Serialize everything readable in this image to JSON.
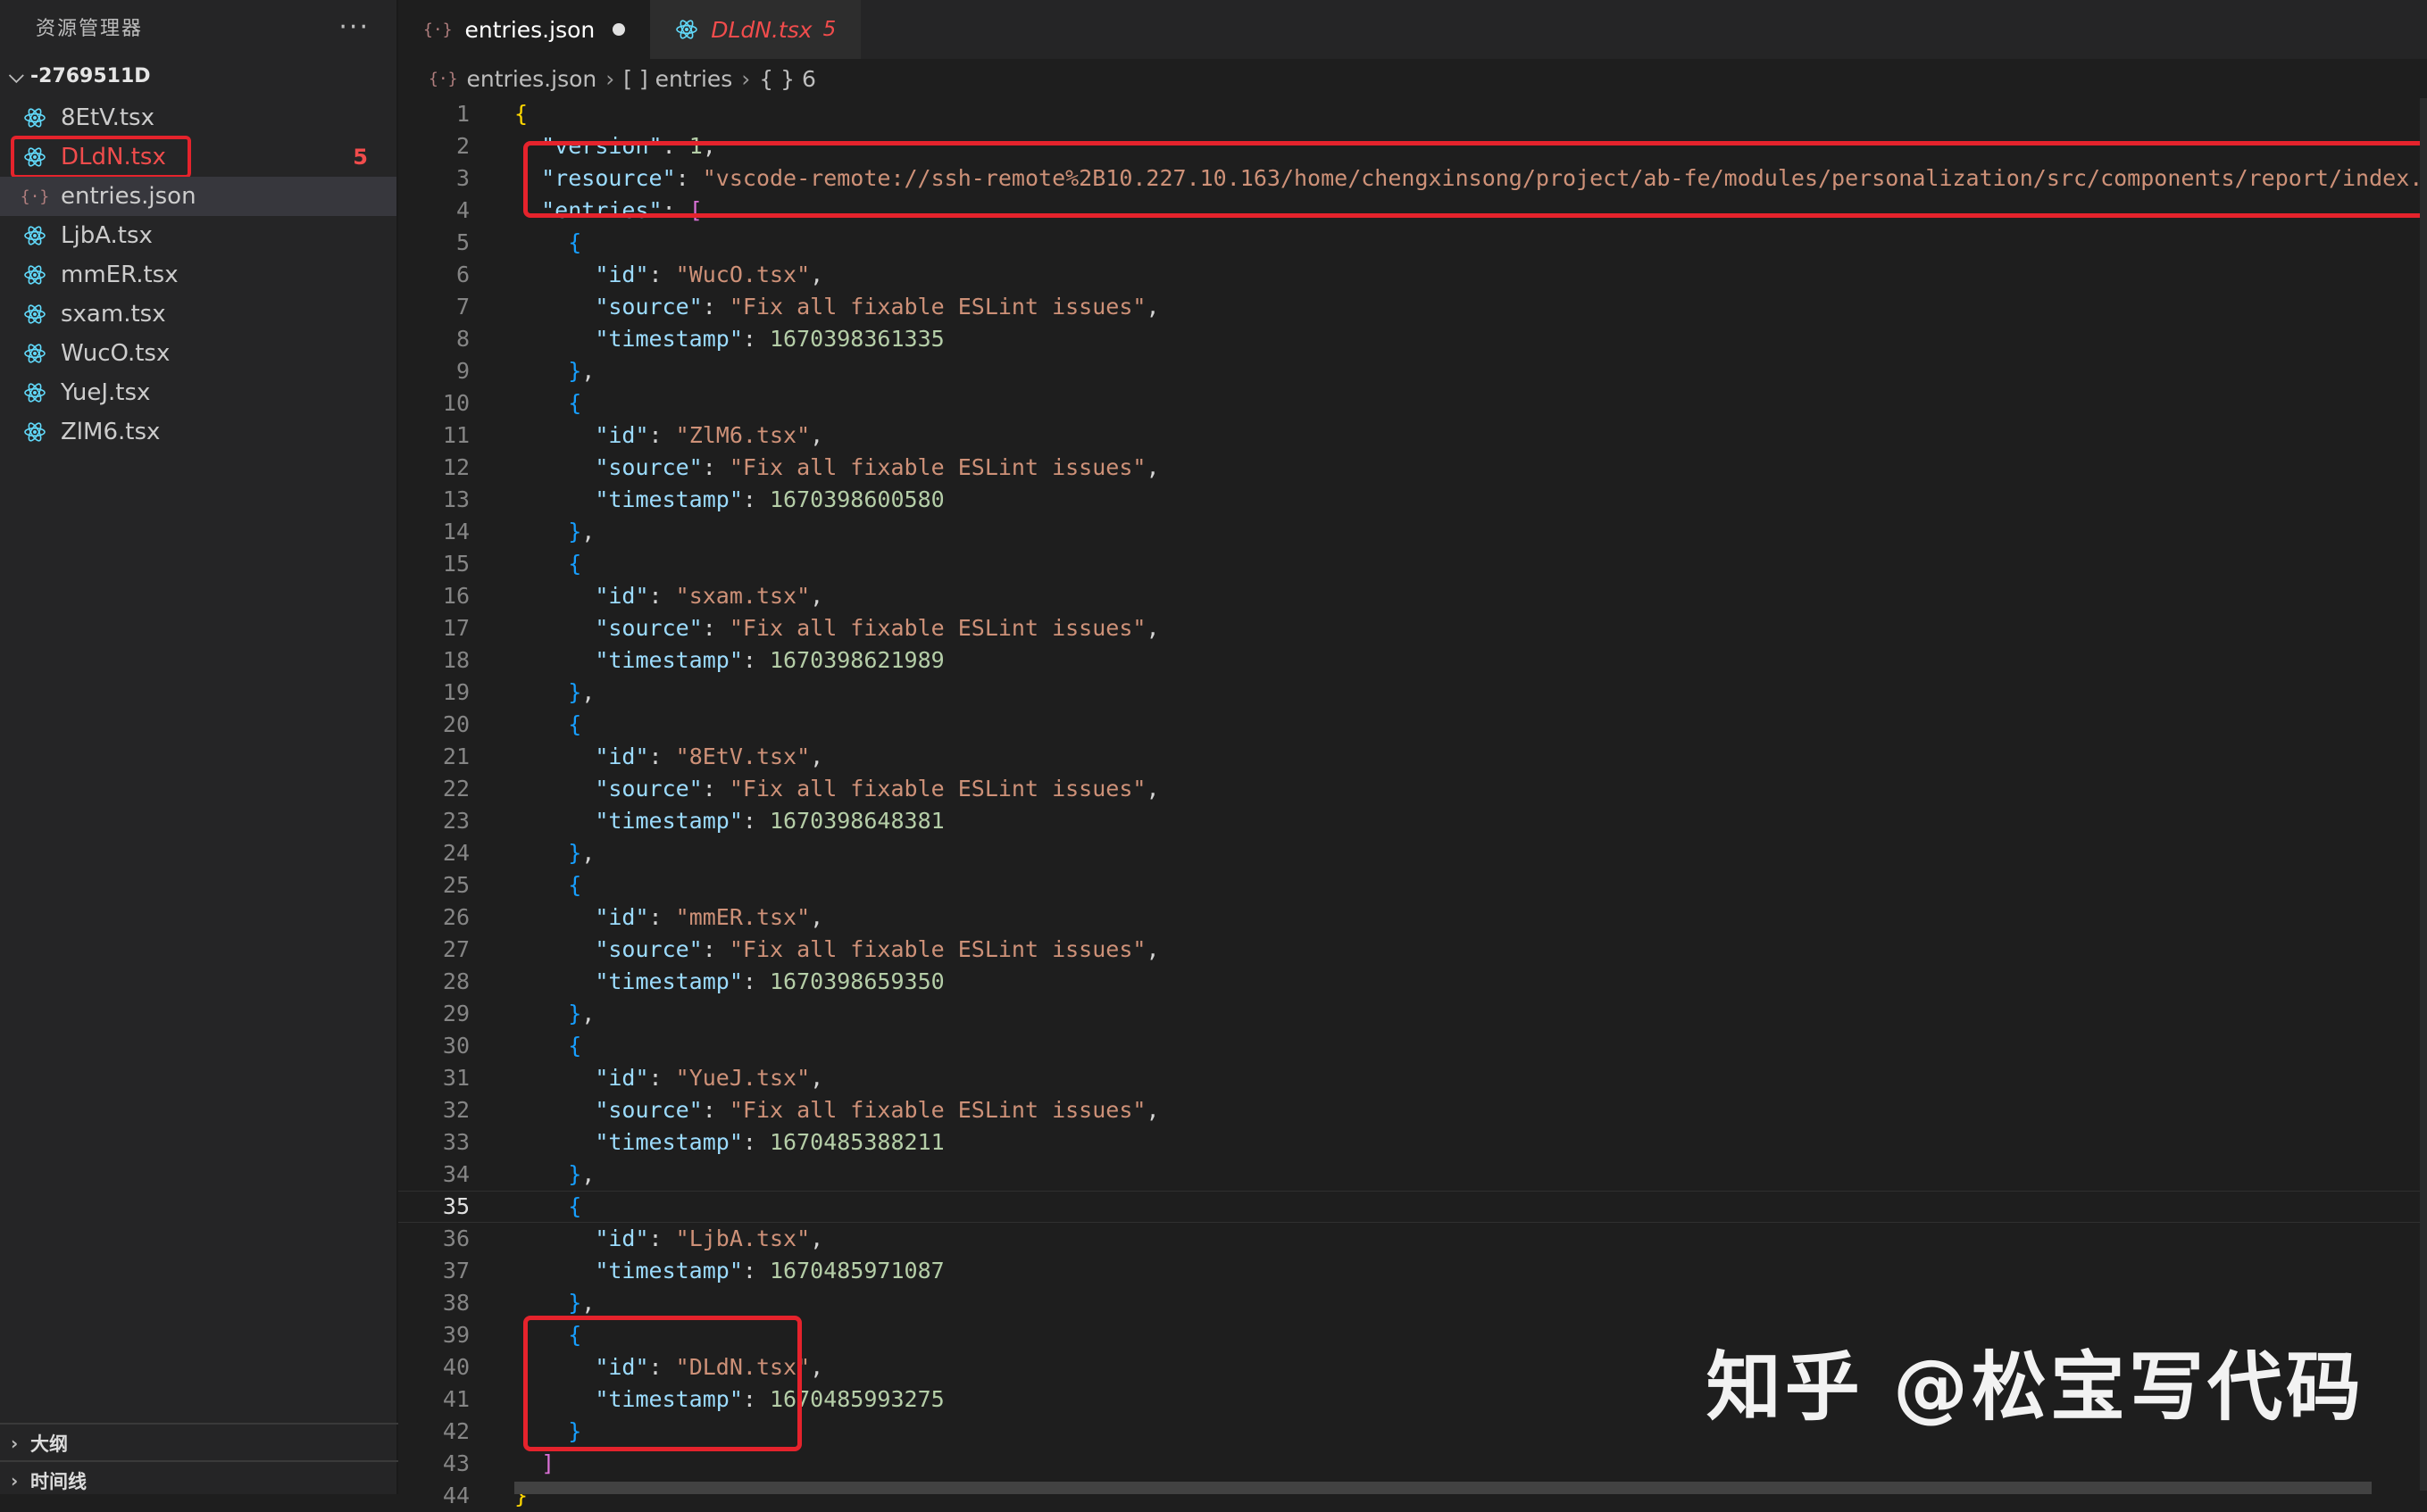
{
  "sidebar": {
    "title": "资源管理器",
    "more": "···",
    "folder": "-2769511D",
    "files": [
      {
        "name": "8EtV.tsx",
        "type": "react"
      },
      {
        "name": "DLdN.tsx",
        "type": "react",
        "badge": "5",
        "error": true
      },
      {
        "name": "entries.json",
        "type": "json",
        "active": true
      },
      {
        "name": "LjbA.tsx",
        "type": "react"
      },
      {
        "name": "mmER.tsx",
        "type": "react"
      },
      {
        "name": "sxam.tsx",
        "type": "react"
      },
      {
        "name": "WucO.tsx",
        "type": "react"
      },
      {
        "name": "YueJ.tsx",
        "type": "react"
      },
      {
        "name": "ZlM6.tsx",
        "type": "react"
      }
    ],
    "panels": [
      "大纲",
      "时间线"
    ]
  },
  "tabs": [
    {
      "label": "entries.json",
      "type": "json",
      "active": true,
      "dirty": true
    },
    {
      "label": "DLdN.tsx",
      "type": "react",
      "count": "5"
    }
  ],
  "breadcrumb": [
    "entries.json",
    "[ ] entries",
    "{ } 6"
  ],
  "code": {
    "current_line": 35,
    "lines": [
      "{",
      "  \"version\": 1,",
      "  \"resource\": \"vscode-remote://ssh-remote%2B10.227.10.163/home/chengxinsong/project/ab-fe/modules/personalization/src/components/report/index.tsx\",",
      "  \"entries\": [",
      "    {",
      "      \"id\": \"WucO.tsx\",",
      "      \"source\": \"Fix all fixable ESLint issues\",",
      "      \"timestamp\": 1670398361335",
      "    },",
      "    {",
      "      \"id\": \"ZlM6.tsx\",",
      "      \"source\": \"Fix all fixable ESLint issues\",",
      "      \"timestamp\": 1670398600580",
      "    },",
      "    {",
      "      \"id\": \"sxam.tsx\",",
      "      \"source\": \"Fix all fixable ESLint issues\",",
      "      \"timestamp\": 1670398621989",
      "    },",
      "    {",
      "      \"id\": \"8EtV.tsx\",",
      "      \"source\": \"Fix all fixable ESLint issues\",",
      "      \"timestamp\": 1670398648381",
      "    },",
      "    {",
      "      \"id\": \"mmER.tsx\",",
      "      \"source\": \"Fix all fixable ESLint issues\",",
      "      \"timestamp\": 1670398659350",
      "    },",
      "    {",
      "      \"id\": \"YueJ.tsx\",",
      "      \"source\": \"Fix all fixable ESLint issues\",",
      "      \"timestamp\": 1670485388211",
      "    },",
      "    {",
      "      \"id\": \"LjbA.tsx\",",
      "      \"timestamp\": 1670485971087",
      "    },",
      "    {",
      "      \"id\": \"DLdN.tsx\",",
      "      \"timestamp\": 1670485993275",
      "    }",
      "  ]",
      "}"
    ]
  },
  "watermark": "知乎 @松宝写代码",
  "colors": {
    "annotation": "#e5232c",
    "error": "#f14c4c",
    "react": "#61dafb"
  }
}
